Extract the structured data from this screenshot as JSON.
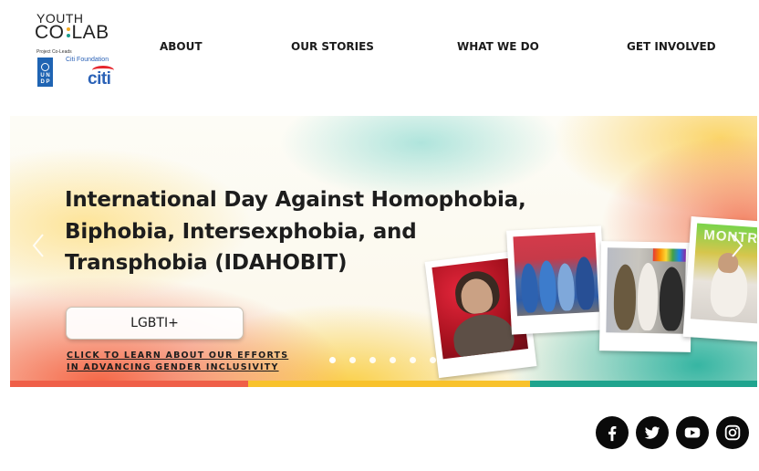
{
  "logo": {
    "line1": "YOUTH",
    "co": "CO",
    "lab": "LAB",
    "co_leads_label": "Project Co-Leads",
    "undp_text": [
      "U N",
      "D P"
    ],
    "citi_foundation": "Citi Foundation",
    "citi": "citi"
  },
  "nav": {
    "about": "ABOUT",
    "our_stories": "OUR STORIES",
    "what_we_do": "WHAT WE DO",
    "get_involved": "GET INVOLVED"
  },
  "hero": {
    "title": "International Day Against Homophobia, Biphobia, Intersexphobia, and Transphobia (IDAHOBIT)",
    "pill_label": "LGBTI+",
    "learn_line1": "CLICK TO LEARN ABOUT OUR EFFORTS",
    "learn_line2": "IN ADVANCING GENDER INCLUSIVITY",
    "photo_sign_text": "MONTR",
    "slide_count": 6,
    "active_slide": 1
  },
  "colors": {
    "bar_red": "#ef5f48",
    "bar_yellow": "#f8c22c",
    "bar_teal": "#1fa48e"
  },
  "social": [
    {
      "name": "facebook-icon"
    },
    {
      "name": "twitter-icon"
    },
    {
      "name": "youtube-icon"
    },
    {
      "name": "instagram-icon"
    }
  ]
}
